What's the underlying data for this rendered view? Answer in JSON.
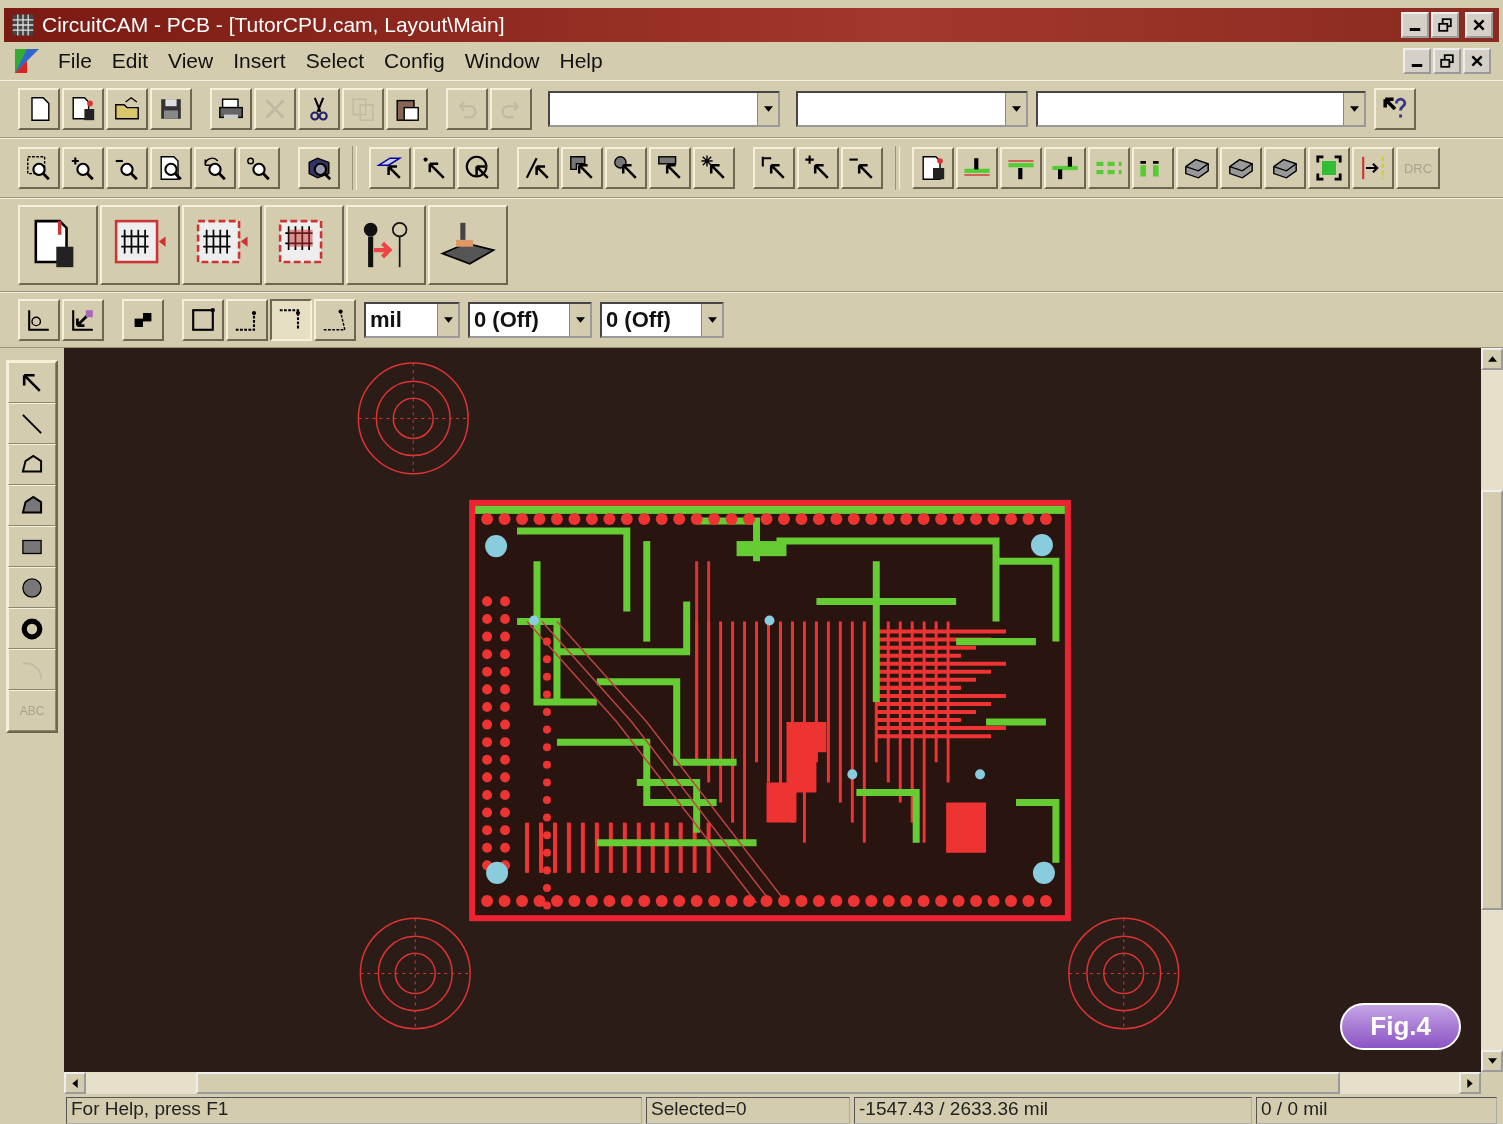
{
  "window": {
    "title": "CircuitCAM - PCB - [TutorCPU.cam, Layout\\Main]"
  },
  "menu": [
    "File",
    "Edit",
    "View",
    "Insert",
    "Select",
    "Config",
    "Window",
    "Help"
  ],
  "standard_toolbar": {
    "buttons": [
      {
        "kind": "new",
        "disabled": false
      },
      {
        "kind": "new-from",
        "disabled": false
      },
      {
        "kind": "open",
        "disabled": false
      },
      {
        "kind": "save",
        "disabled": false
      },
      {
        "kind": "sep"
      },
      {
        "kind": "print",
        "disabled": false
      },
      {
        "kind": "delete",
        "disabled": true
      },
      {
        "kind": "cut",
        "disabled": false
      },
      {
        "kind": "copy",
        "disabled": true
      },
      {
        "kind": "paste",
        "disabled": false
      },
      {
        "kind": "sep"
      },
      {
        "kind": "undo",
        "disabled": true
      },
      {
        "kind": "redo",
        "disabled": true
      }
    ]
  },
  "view_toolbar": {
    "buttons": [
      {
        "kind": "zoom-window"
      },
      {
        "kind": "zoom-in"
      },
      {
        "kind": "zoom-out"
      },
      {
        "kind": "zoom-page"
      },
      {
        "kind": "zoom-previous"
      },
      {
        "kind": "zoom-origin"
      },
      {
        "kind": "sep"
      },
      {
        "kind": "zoom-3d"
      },
      {
        "kind": "bar"
      },
      {
        "kind": "select-area"
      },
      {
        "kind": "select-point"
      },
      {
        "kind": "select-circle"
      },
      {
        "kind": "sep"
      },
      {
        "kind": "select-line"
      },
      {
        "kind": "select-polygon"
      },
      {
        "kind": "select-magnify"
      },
      {
        "kind": "select-rect"
      },
      {
        "kind": "select-star"
      },
      {
        "kind": "sep"
      },
      {
        "kind": "select-flag"
      },
      {
        "kind": "select-add"
      },
      {
        "kind": "select-remove"
      },
      {
        "kind": "bar"
      },
      {
        "kind": "layer-file"
      },
      {
        "kind": "layer-top"
      },
      {
        "kind": "layer-bottom"
      },
      {
        "kind": "layer-both"
      },
      {
        "kind": "layer-dashed"
      },
      {
        "kind": "layer-gap"
      },
      {
        "kind": "board"
      },
      {
        "kind": "board"
      },
      {
        "kind": "board"
      },
      {
        "kind": "frame"
      },
      {
        "kind": "cut-line"
      },
      {
        "kind": "drc",
        "label": "DRC",
        "disabled": true
      }
    ]
  },
  "process_toolbar": {
    "buttons": [
      {
        "kind": "import"
      },
      {
        "kind": "insulate"
      },
      {
        "kind": "insulate-b"
      },
      {
        "kind": "insulate-c"
      },
      {
        "kind": "contour"
      },
      {
        "kind": "mill"
      }
    ]
  },
  "edit_toolbar": {
    "buttons": [
      {
        "kind": "zero"
      },
      {
        "kind": "origin"
      },
      {
        "kind": "sep"
      },
      {
        "kind": "flip"
      },
      {
        "kind": "sep"
      },
      {
        "kind": "corner-rect",
        "selected": false
      },
      {
        "kind": "corner-down",
        "selected": false
      },
      {
        "kind": "corner-up",
        "selected": true
      },
      {
        "kind": "corner-angle",
        "selected": false
      }
    ],
    "unit": "mil",
    "snap_1": "0 (Off)",
    "snap_2": "0 (Off)"
  },
  "tool_palette": [
    {
      "kind": "pointer",
      "disabled": false
    },
    {
      "kind": "line",
      "disabled": false
    },
    {
      "kind": "polygon",
      "disabled": false
    },
    {
      "kind": "polygon-filled",
      "disabled": false
    },
    {
      "kind": "rect",
      "disabled": false
    },
    {
      "kind": "circle",
      "disabled": false
    },
    {
      "kind": "ring",
      "disabled": false
    },
    {
      "kind": "arc",
      "disabled": true
    },
    {
      "kind": "text",
      "label": "ABC",
      "disabled": true
    }
  ],
  "figure_label": "Fig.4",
  "status_bar": [
    "For Help, press F1",
    "Selected=0",
    "-1547.43 / 2633.36 mil",
    "0 / 0 mil"
  ]
}
